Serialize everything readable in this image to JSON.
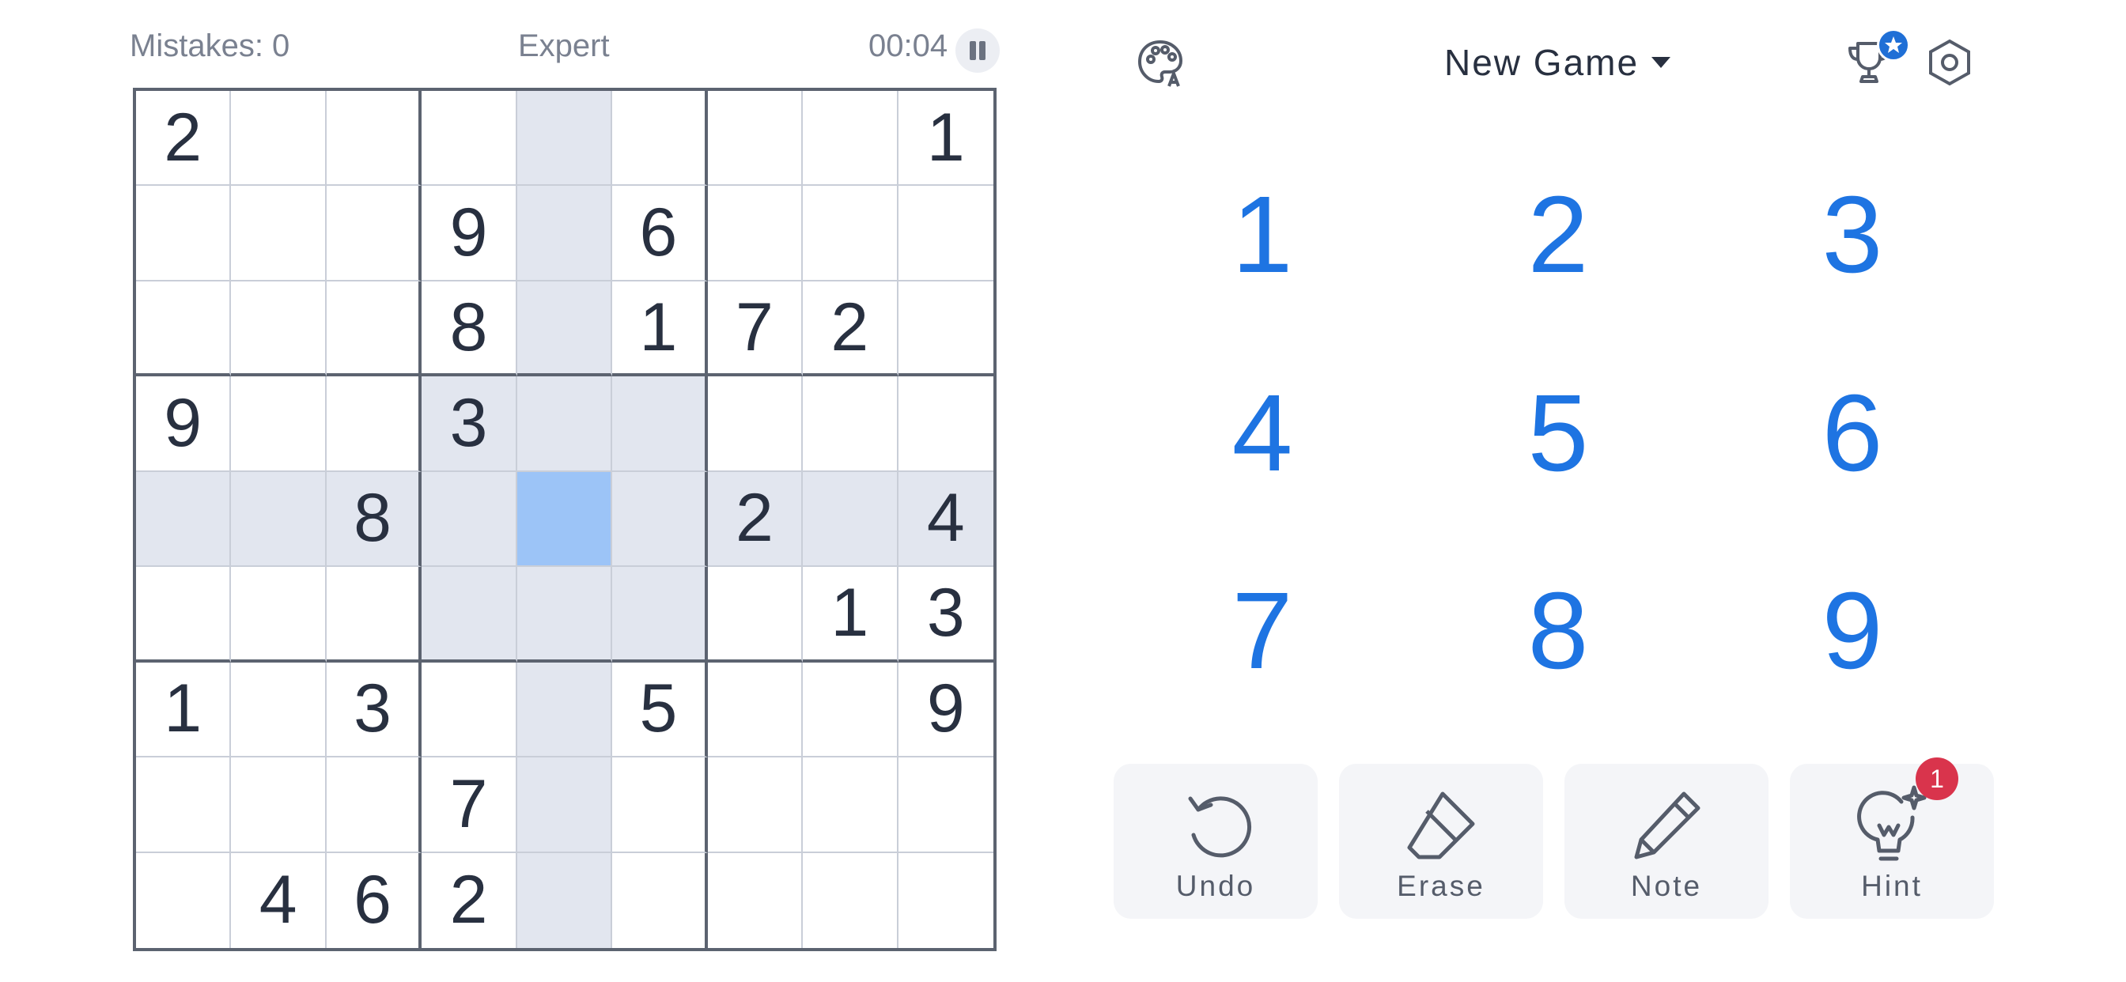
{
  "status": {
    "mistakes": "Mistakes: 0",
    "difficulty": "Expert",
    "timer": "00:04"
  },
  "header": {
    "new_game": "New Game"
  },
  "board": {
    "grid": [
      [
        "2",
        "",
        "",
        "",
        "",
        "",
        "",
        "",
        "1"
      ],
      [
        "",
        "",
        "",
        "9",
        "",
        "6",
        "",
        "",
        ""
      ],
      [
        "",
        "",
        "",
        "8",
        "",
        "1",
        "7",
        "2",
        ""
      ],
      [
        "9",
        "",
        "",
        "3",
        "",
        "",
        "",
        "",
        ""
      ],
      [
        "",
        "",
        "8",
        "",
        "",
        "",
        "2",
        "",
        "4"
      ],
      [
        "",
        "",
        "",
        "",
        "",
        "",
        "",
        "1",
        "3"
      ],
      [
        "1",
        "",
        "3",
        "",
        "",
        "5",
        "",
        "",
        "9"
      ],
      [
        "",
        "",
        "",
        "7",
        "",
        "",
        "",
        "",
        ""
      ],
      [
        "",
        "4",
        "6",
        "2",
        "",
        "",
        "",
        "",
        ""
      ]
    ],
    "selected": {
      "row": 4,
      "col": 4
    }
  },
  "numpad": [
    "1",
    "2",
    "3",
    "4",
    "5",
    "6",
    "7",
    "8",
    "9"
  ],
  "tools": [
    {
      "label": "Undo",
      "icon": "undo-icon"
    },
    {
      "label": "Erase",
      "icon": "eraser-icon"
    },
    {
      "label": "Note",
      "icon": "pencil-icon"
    },
    {
      "label": "Hint",
      "icon": "lightbulb-icon",
      "badge": "1"
    }
  ],
  "colors": {
    "accent": "#1e74e2",
    "selected_cell": "#9cc4f7",
    "highlight": "#e2e6ef",
    "badge": "#d9344c"
  },
  "icons": [
    "palette-icon",
    "pause-icon",
    "trophy-icon",
    "settings-hexagon-icon"
  ]
}
